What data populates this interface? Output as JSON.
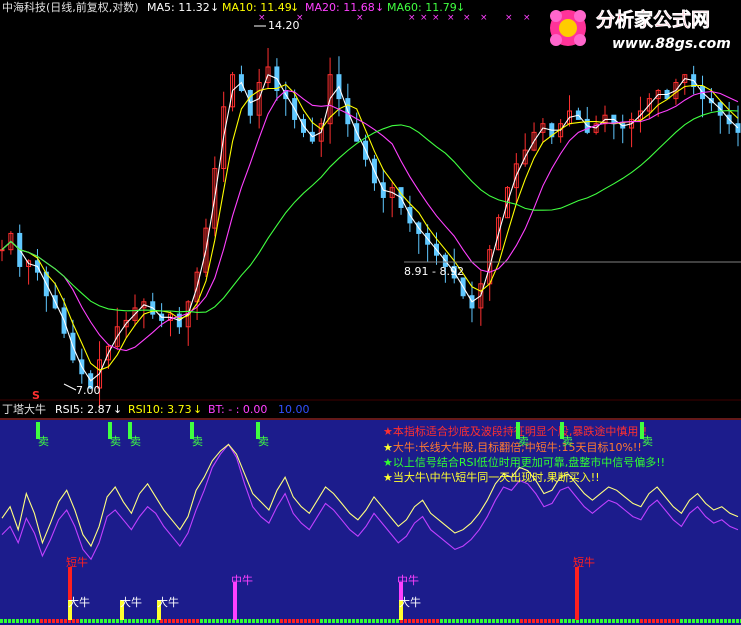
{
  "header": {
    "title": "中海科技(日线,前复权,对数)",
    "ma5": "MA5: 11.32",
    "ma10": "MA10: 11.49",
    "ma20": "MA20: 11.68",
    "ma60": "MA60: 11.79",
    "arrow_down": "↓"
  },
  "watermark": {
    "brand": "分析家公式网",
    "url": "www.88gs.com"
  },
  "price_annotations": {
    "high": "14.20",
    "low": "7.00",
    "range": "8.91 - 8.92",
    "signal_s": "S"
  },
  "indicator_header": {
    "name": "丁塔大牛",
    "rsi5": "RSI5: 2.87",
    "rsi10": "RSI10: 3.73",
    "bt": "BT: - : 0.00",
    "extra": "10.00"
  },
  "notes": [
    {
      "star": "★",
      "text": "本指标适合抄底及波段持征明显个股,暴跌途中慎用!!",
      "color": "#ff3030"
    },
    {
      "star": "★",
      "text": "大牛:长线大牛股,目标翻倍;中短牛:15天目标10%!!",
      "color": "#ffff30"
    },
    {
      "star": "★",
      "text": "以上信号结合RSI低位时用更加可靠,盘整市中信号偏多!!",
      "color": "#30ff30"
    },
    {
      "star": "★",
      "text": "当大牛\\中牛\\短牛同一天出现时,果断买入!!",
      "color": "#ffff30"
    }
  ],
  "signals": {
    "sell": "卖",
    "big_bull": "大牛",
    "mid_bull": "中牛",
    "short_bull": "短牛"
  },
  "colors": {
    "bg_price": "#000000",
    "bg_indicator": "#1c1c8c",
    "candle_up": "#ff3030",
    "candle_down": "#60c8ff",
    "ma5": "#ffffff",
    "ma10": "#ffff00",
    "ma20": "#ff40ff",
    "ma60": "#40ff40",
    "rsi5": "#ffffff",
    "rsi10": "#ffff00",
    "rsi_fast": "#ffff80",
    "rsi_slow": "#c040ff"
  },
  "chart_data": [
    {
      "type": "candlestick",
      "title": "中海科技(日线,前复权,对数)",
      "series": [
        {
          "name": "MA5",
          "color": "#ffffff"
        },
        {
          "name": "MA10",
          "color": "#ffff00"
        },
        {
          "name": "MA20",
          "color": "#ff40ff"
        },
        {
          "name": "MA60",
          "color": "#40ff40"
        }
      ],
      "annotations": [
        "14.20",
        "7.00",
        "8.91 - 8.92"
      ],
      "close_path": [
        9.2,
        9.5,
        8.9,
        9.0,
        8.8,
        8.4,
        8.2,
        7.8,
        7.4,
        7.2,
        7.0,
        7.4,
        7.6,
        7.9,
        8.0,
        8.2,
        8.3,
        8.1,
        8.0,
        8.1,
        7.9,
        8.3,
        8.8,
        9.6,
        10.8,
        12.2,
        13.0,
        12.6,
        12.0,
        12.8,
        13.2,
        12.6,
        12.4,
        11.9,
        11.6,
        11.4,
        11.8,
        13.0,
        12.4,
        11.8,
        11.4,
        11.0,
        10.5,
        10.2,
        10.4,
        10.0,
        9.7,
        9.5,
        9.3,
        9.1,
        8.9,
        8.7,
        8.4,
        8.2,
        8.6,
        9.2,
        9.8,
        10.4,
        10.9,
        11.2,
        11.6,
        11.8,
        11.5,
        11.8,
        12.1,
        11.9,
        11.6,
        11.8,
        12.0,
        11.8,
        11.7,
        11.9,
        12.1,
        12.4,
        12.6,
        12.4,
        12.8,
        13.0,
        12.7,
        12.4,
        12.3,
        12.0,
        11.8,
        11.6
      ],
      "high_label": "14.20",
      "low_label": "7.00"
    },
    {
      "type": "line",
      "title": "丁塔大牛",
      "series": [
        {
          "name": "RSI5",
          "color": "#ffffff",
          "last": 2.87
        },
        {
          "name": "RSI10",
          "color": "#ffff00",
          "last": 3.73
        }
      ],
      "rsi_fast": [
        45,
        52,
        38,
        60,
        48,
        30,
        42,
        55,
        62,
        50,
        35,
        28,
        40,
        58,
        64,
        55,
        48,
        60,
        66,
        58,
        50,
        44,
        38,
        46,
        62,
        70,
        80,
        86,
        90,
        84,
        72,
        60,
        55,
        50,
        62,
        70,
        58,
        52,
        48,
        56,
        64,
        60,
        54,
        48,
        44,
        50,
        58,
        52,
        46,
        40,
        44,
        52,
        56,
        48,
        44,
        40,
        36,
        38,
        42,
        48,
        56,
        66,
        72,
        70,
        76,
        74,
        68,
        60,
        62,
        70,
        72,
        66,
        60,
        56,
        60,
        64,
        62,
        58,
        54,
        52,
        60,
        64,
        58,
        52,
        48,
        56,
        60,
        54,
        50,
        52,
        48,
        46
      ],
      "rsi_slow": [
        35,
        40,
        30,
        45,
        36,
        22,
        32,
        44,
        50,
        40,
        26,
        20,
        30,
        46,
        50,
        44,
        38,
        46,
        52,
        48,
        40,
        34,
        28,
        36,
        50,
        62,
        76,
        84,
        90,
        82,
        66,
        52,
        46,
        42,
        52,
        60,
        48,
        42,
        38,
        46,
        54,
        50,
        44,
        38,
        34,
        40,
        48,
        42,
        36,
        30,
        34,
        42,
        46,
        38,
        34,
        30,
        26,
        28,
        32,
        38,
        46,
        56,
        64,
        62,
        68,
        66,
        60,
        52,
        54,
        62,
        64,
        58,
        52,
        48,
        52,
        56,
        54,
        50,
        46,
        44,
        52,
        56,
        50,
        44,
        40,
        48,
        52,
        46,
        42,
        44,
        40,
        38
      ],
      "signals": [
        {
          "label": "卖",
          "index": 12
        },
        {
          "label": "卖",
          "index": 40
        },
        {
          "label": "卖",
          "index": 46
        },
        {
          "label": "卖",
          "index": 68
        },
        {
          "label": "卖",
          "index": 92
        },
        {
          "label": "大牛",
          "index": 25
        },
        {
          "label": "大牛",
          "index": 43
        },
        {
          "label": "大牛",
          "index": 56
        },
        {
          "label": "大牛",
          "index": 143
        },
        {
          "label": "中牛",
          "index": 84
        },
        {
          "label": "中牛",
          "index": 143
        },
        {
          "label": "短牛",
          "index": 25
        },
        {
          "label": "短牛",
          "index": 207
        }
      ]
    }
  ]
}
